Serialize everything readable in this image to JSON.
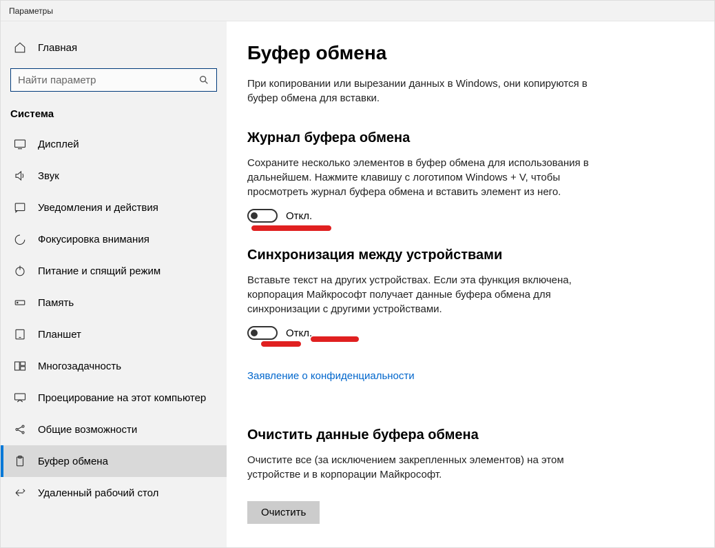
{
  "window": {
    "title": "Параметры"
  },
  "sidebar": {
    "home": "Главная",
    "search_placeholder": "Найти параметр",
    "section": "Система",
    "items": [
      {
        "icon": "display-icon",
        "label": "Дисплей"
      },
      {
        "icon": "sound-icon",
        "label": "Звук"
      },
      {
        "icon": "notification-icon",
        "label": "Уведомления и действия"
      },
      {
        "icon": "focus-icon",
        "label": "Фокусировка внимания"
      },
      {
        "icon": "power-icon",
        "label": "Питание и спящий режим"
      },
      {
        "icon": "storage-icon",
        "label": "Память"
      },
      {
        "icon": "tablet-icon",
        "label": "Планшет"
      },
      {
        "icon": "multitask-icon",
        "label": "Многозадачность"
      },
      {
        "icon": "project-icon",
        "label": "Проецирование на этот компьютер"
      },
      {
        "icon": "shared-icon",
        "label": "Общие возможности"
      },
      {
        "icon": "clipboard-icon",
        "label": "Буфер обмена"
      },
      {
        "icon": "remote-icon",
        "label": "Удаленный рабочий стол"
      }
    ]
  },
  "main": {
    "title": "Буфер обмена",
    "intro": "При копировании или вырезании данных в Windows, они копируются в буфер обмена для вставки.",
    "history": {
      "heading": "Журнал буфера обмена",
      "desc": "Сохраните несколько элементов в буфер обмена для использования в дальнейшем. Нажмите клавишу с логотипом Windows + V, чтобы просмотреть журнал буфера обмена и вставить элемент из него.",
      "state": "Откл."
    },
    "sync": {
      "heading": "Синхронизация между устройствами",
      "desc": "Вставьте текст на других устройствах. Если эта функция включена, корпорация Майкрософт получает данные буфера обмена для синхронизации с другими устройствами.",
      "state": "Откл.",
      "privacy_link": "Заявление о конфиденциальности"
    },
    "clear": {
      "heading": "Очистить данные буфера обмена",
      "desc": "Очистите все (за исключением закрепленных элементов) на этом устройстве и в корпорации Майкрософт.",
      "button": "Очистить"
    }
  }
}
